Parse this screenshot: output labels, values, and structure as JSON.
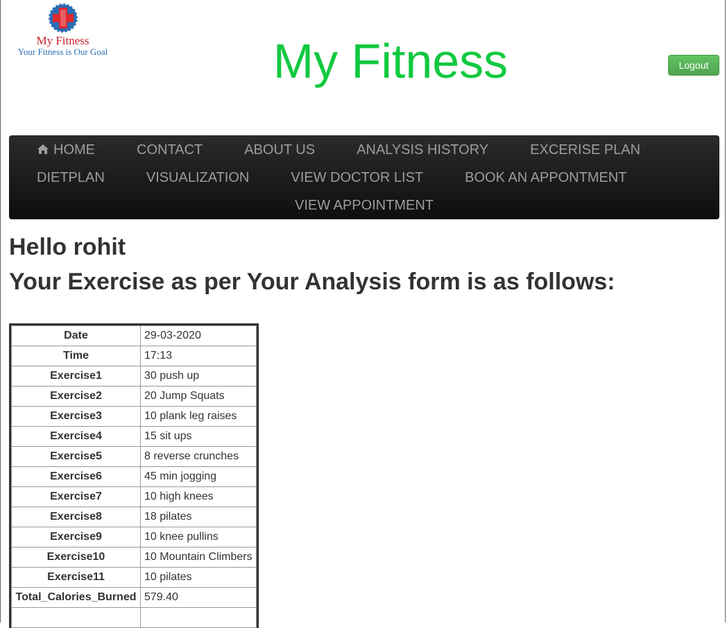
{
  "brand": {
    "logo_name": "My Fitness",
    "logo_tagline": "Your Fitness is Our Goal",
    "site_title": "My Fitness",
    "title_color": "#12c940"
  },
  "header": {
    "logout_label": "Logout"
  },
  "nav": {
    "row1": [
      "HOME",
      "CONTACT",
      "ABOUT US",
      "ANALYSIS HISTORY",
      "EXCERISE PLAN"
    ],
    "row2": [
      "DIETPLAN",
      "VISUALIZATION",
      "VIEW DOCTOR LIST",
      "BOOK AN APPONTMENT"
    ],
    "row3": [
      "VIEW APPOINTMENT"
    ],
    "home_icon": "home-icon"
  },
  "main": {
    "greeting": "Hello rohit",
    "subtitle": "Your Exercise as per Your Analysis form is as follows:"
  },
  "exercise_table": {
    "rows": [
      {
        "key": "Date",
        "value": "29-03-2020"
      },
      {
        "key": "Time",
        "value": "17:13"
      },
      {
        "key": "Exercise1",
        "value": "30 push up"
      },
      {
        "key": "Exercise2",
        "value": "20 Jump Squats"
      },
      {
        "key": "Exercise3",
        "value": "10 plank leg raises"
      },
      {
        "key": "Exercise4",
        "value": "15 sit ups"
      },
      {
        "key": "Exercise5",
        "value": "8 reverse crunches"
      },
      {
        "key": "Exercise6",
        "value": "45 min jogging"
      },
      {
        "key": "Exercise7",
        "value": "10 high knees"
      },
      {
        "key": "Exercise8",
        "value": "18 pilates"
      },
      {
        "key": "Exercise9",
        "value": "10 knee pullins"
      },
      {
        "key": "Exercise10",
        "value": "10 Mountain Climbers"
      },
      {
        "key": "Exercise11",
        "value": "10 pilates"
      },
      {
        "key": "Total_Calories_Burned",
        "value": "579.40"
      },
      {
        "key": "",
        "value": ""
      }
    ]
  }
}
